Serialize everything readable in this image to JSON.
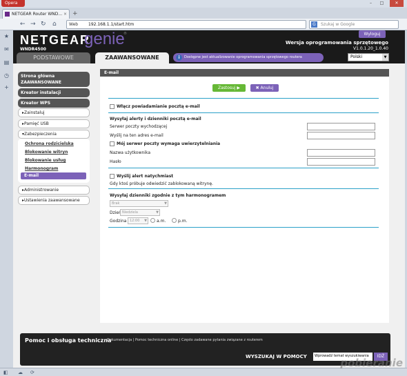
{
  "browser": {
    "menu_label": "Opera",
    "tab_title": "NETGEAR Router WND...",
    "tab_close": "×",
    "new_tab": "+",
    "address_prefix": "Web",
    "url": "192.168.1.1/start.htm",
    "search_placeholder": "Szukaj w Google",
    "search_engine": "G"
  },
  "header": {
    "brand": "NETGEAR",
    "product": "genie",
    "trademark": "®",
    "model": "WNDR4500",
    "logout": "Wyloguj",
    "firmware_label": "Wersja oprogramowania sprzętowego",
    "firmware_version": "V1.0.1.20_1.0.40",
    "tab_basic": "PODSTAWOWE",
    "tab_advanced": "ZAAWANSOWANE",
    "update_notice": "Dostępne jest aktualizowanie oprogramowania sprzętowego routera",
    "update_icon_glyph": "i",
    "language": "Polski",
    "accent_color": "#7c62b8"
  },
  "nav": {
    "home": [
      "Strona główna",
      "ZAAWANSOWANE"
    ],
    "setup_wizard": "Kreator instalacji",
    "wps_wizard": "Kreator WPS",
    "setup": "Zainstaluj",
    "usb": "Pamięć USB",
    "security": "Zabezpieczenia",
    "security_items": [
      "Ochrona rodzicielska",
      "Blokowanie witryn",
      "Blokowanie usług",
      "Harmonogram",
      "E-mail"
    ],
    "admin": "Administrowanie",
    "advanced_setup": "Ustawienia zaawansowane"
  },
  "main": {
    "title": "E-mail",
    "apply": "Zastosuj ▶",
    "cancel": "✖ Anuluj",
    "enable_notify": "Włącz powiadamianie pocztą e-mail",
    "send_alerts_heading": "Wysyłaj alerty i dzienniki pocztą e-mail",
    "smtp_server": "Serwer poczty wychodzącej",
    "send_to": "Wyślij na ten adres e-mail",
    "auth_required": "Mój serwer poczty wymaga uwierzytelniania",
    "username": "Nazwa użytkownika",
    "password": "Hasło",
    "alert_immediately": "Wyślij alert natychmiast",
    "alert_desc": "Gdy ktoś próbuje odwiedzić zablokowaną witrynę.",
    "schedule_heading": "Wysyłaj dzienniki zgodnie z tym harmonogramem",
    "schedule_value": "Brak",
    "day_label": "Dzień",
    "day_value": "Niedziela",
    "time_label": "Godzina",
    "time_value": "12:00",
    "am": "a.m.",
    "pm": "p.m."
  },
  "footer": {
    "title": "Pomoc i obsługa techniczna",
    "links": "Dokumentacja | Pomoc techniczna online | Często zadawane pytania związane z routerem",
    "search_label": "WYSZUKAJ W POMOCY",
    "search_placeholder": "Wprowadź temat wyszukiwania",
    "go": "IDŹ"
  },
  "watermark": "pobieranie"
}
